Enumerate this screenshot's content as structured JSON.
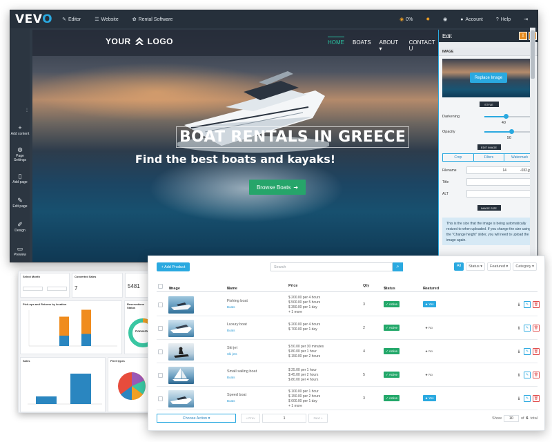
{
  "topbar": {
    "brand_main": "VEV",
    "brand_accent": "O",
    "nav": [
      {
        "label": "Editor"
      },
      {
        "label": "Website"
      },
      {
        "label": "Rental Software"
      }
    ],
    "progress": "0%",
    "account_label": "Account",
    "help_label": "Help"
  },
  "left_tools": [
    {
      "label": "Add content",
      "icon": "plus-icon"
    },
    {
      "label": "Page Settings",
      "icon": "gears-icon"
    },
    {
      "label": "Add page",
      "icon": "file-icon"
    },
    {
      "label": "Edit page",
      "icon": "pencil-icon"
    },
    {
      "label": "Design",
      "icon": "brush-icon"
    },
    {
      "label": "Preview",
      "icon": "monitor-icon"
    }
  ],
  "site": {
    "logo_left": "YOUR",
    "logo_right": "LOGO",
    "menu": [
      "HOME",
      "BOATS",
      "ABOUT ▾",
      "CONTACT U"
    ],
    "hero_title": "BOAT RENTALS IN GREECE",
    "hero_subtitle": "Find the best boats and kayaks!",
    "browse_label": "Browse Boats"
  },
  "edit_panel": {
    "title": "Edit",
    "section_image": "IMAGE",
    "replace_label": "Replace Image",
    "style_chip": "STYLE",
    "darkening_label": "Darkening",
    "darkening_value": "40",
    "opacity_label": "Opacity",
    "opacity_value": "50",
    "edit_image_chip": "EDIT IMAGE",
    "tabs": [
      "Crop",
      "Filters",
      "Watermark"
    ],
    "filename_label": "Filename",
    "filename_num": "14",
    "filename_ext": "-032.jpg",
    "title_label": "Title",
    "alt_label": "ALT",
    "image_size_chip": "IMAGE SIZE",
    "note": "This is the size that the image is being automatically resized to when uploaded. If you change the size using the \"Change height\" slider, you will need to upload the image again."
  },
  "dashboard": {
    "select_month": "Select Month",
    "converted_title": "Converted Sales",
    "converted_value": "7",
    "reservations_value": "5481",
    "pickups_title": "Pick-ups and Returns by location",
    "reservations_title": "Reservations Status",
    "donut_label": "Converted",
    "sales_title": "Sales",
    "fleet_title": "Fleet types",
    "bars_stacked": [
      {
        "blue": 0,
        "orange": 0
      },
      {
        "blue": 0.3,
        "orange": 0.55
      },
      {
        "blue": 0.35,
        "orange": 0.7
      },
      {
        "blue": 0,
        "orange": 0
      }
    ],
    "sales_bars": [
      0.25,
      1.0
    ]
  },
  "products": {
    "add_label": "+ Add Product",
    "search_placeholder": "Search",
    "filters": [
      "All",
      "Status ▾",
      "Featured ▾",
      "Category ▾"
    ],
    "columns": [
      "Image",
      "Name",
      "Price",
      "Qty",
      "Status",
      "Featured"
    ],
    "rows": [
      {
        "name": "Fishing boat",
        "category": "Boats",
        "prices": [
          "$ 200.00 per 4 hours",
          "$ 500.00 per 5 hours",
          "$ 350.00 per 1 day",
          "+ 1 more"
        ],
        "qty": "3",
        "status": "✓ Active",
        "featured": "★ Yes",
        "featured_on": true
      },
      {
        "name": "Luxury boat",
        "category": "Boats",
        "prices": [
          "$ 200.00 per 4 hours",
          "$ 700.00 per 1 day"
        ],
        "qty": "2",
        "status": "✓ Active",
        "featured": "★ No",
        "featured_on": false
      },
      {
        "name": "Ski jet",
        "category": "Ski jets",
        "prices": [
          "$ 50.00 per 30 minutes",
          "$ 80.00 per 1 hour",
          "$ 150.00 per 2 hours"
        ],
        "qty": "4",
        "status": "✓ Active",
        "featured": "★ No",
        "featured_on": false
      },
      {
        "name": "Small sailing boat",
        "category": "Boats",
        "prices": [
          "$ 25.00 per 1 hour",
          "$ 45.00 per 2 hours",
          "$ 80.00 per 4 hours"
        ],
        "qty": "5",
        "status": "✓ Active",
        "featured": "★ No",
        "featured_on": false
      },
      {
        "name": "Speed boat",
        "category": "Boats",
        "prices": [
          "$ 100.00 per 1 hour",
          "$ 150.00 per 2 hours",
          "$ 600.00 per 1 day",
          "+ 1 more"
        ],
        "qty": "3",
        "status": "✓ Active",
        "featured": "★ Yes",
        "featured_on": true
      }
    ],
    "choose_action": "Choose Action ▾",
    "prev_label": "« Prev",
    "page_value": "1",
    "next_label": "Next »",
    "show_label": "Show",
    "per_page": "10",
    "of_label": "of",
    "total_pages": "6",
    "total_label": "total"
  },
  "colors": {
    "accent": "#2aa9e0",
    "green": "#26a56a",
    "orange": "#f0a024",
    "dark": "#26303b"
  }
}
